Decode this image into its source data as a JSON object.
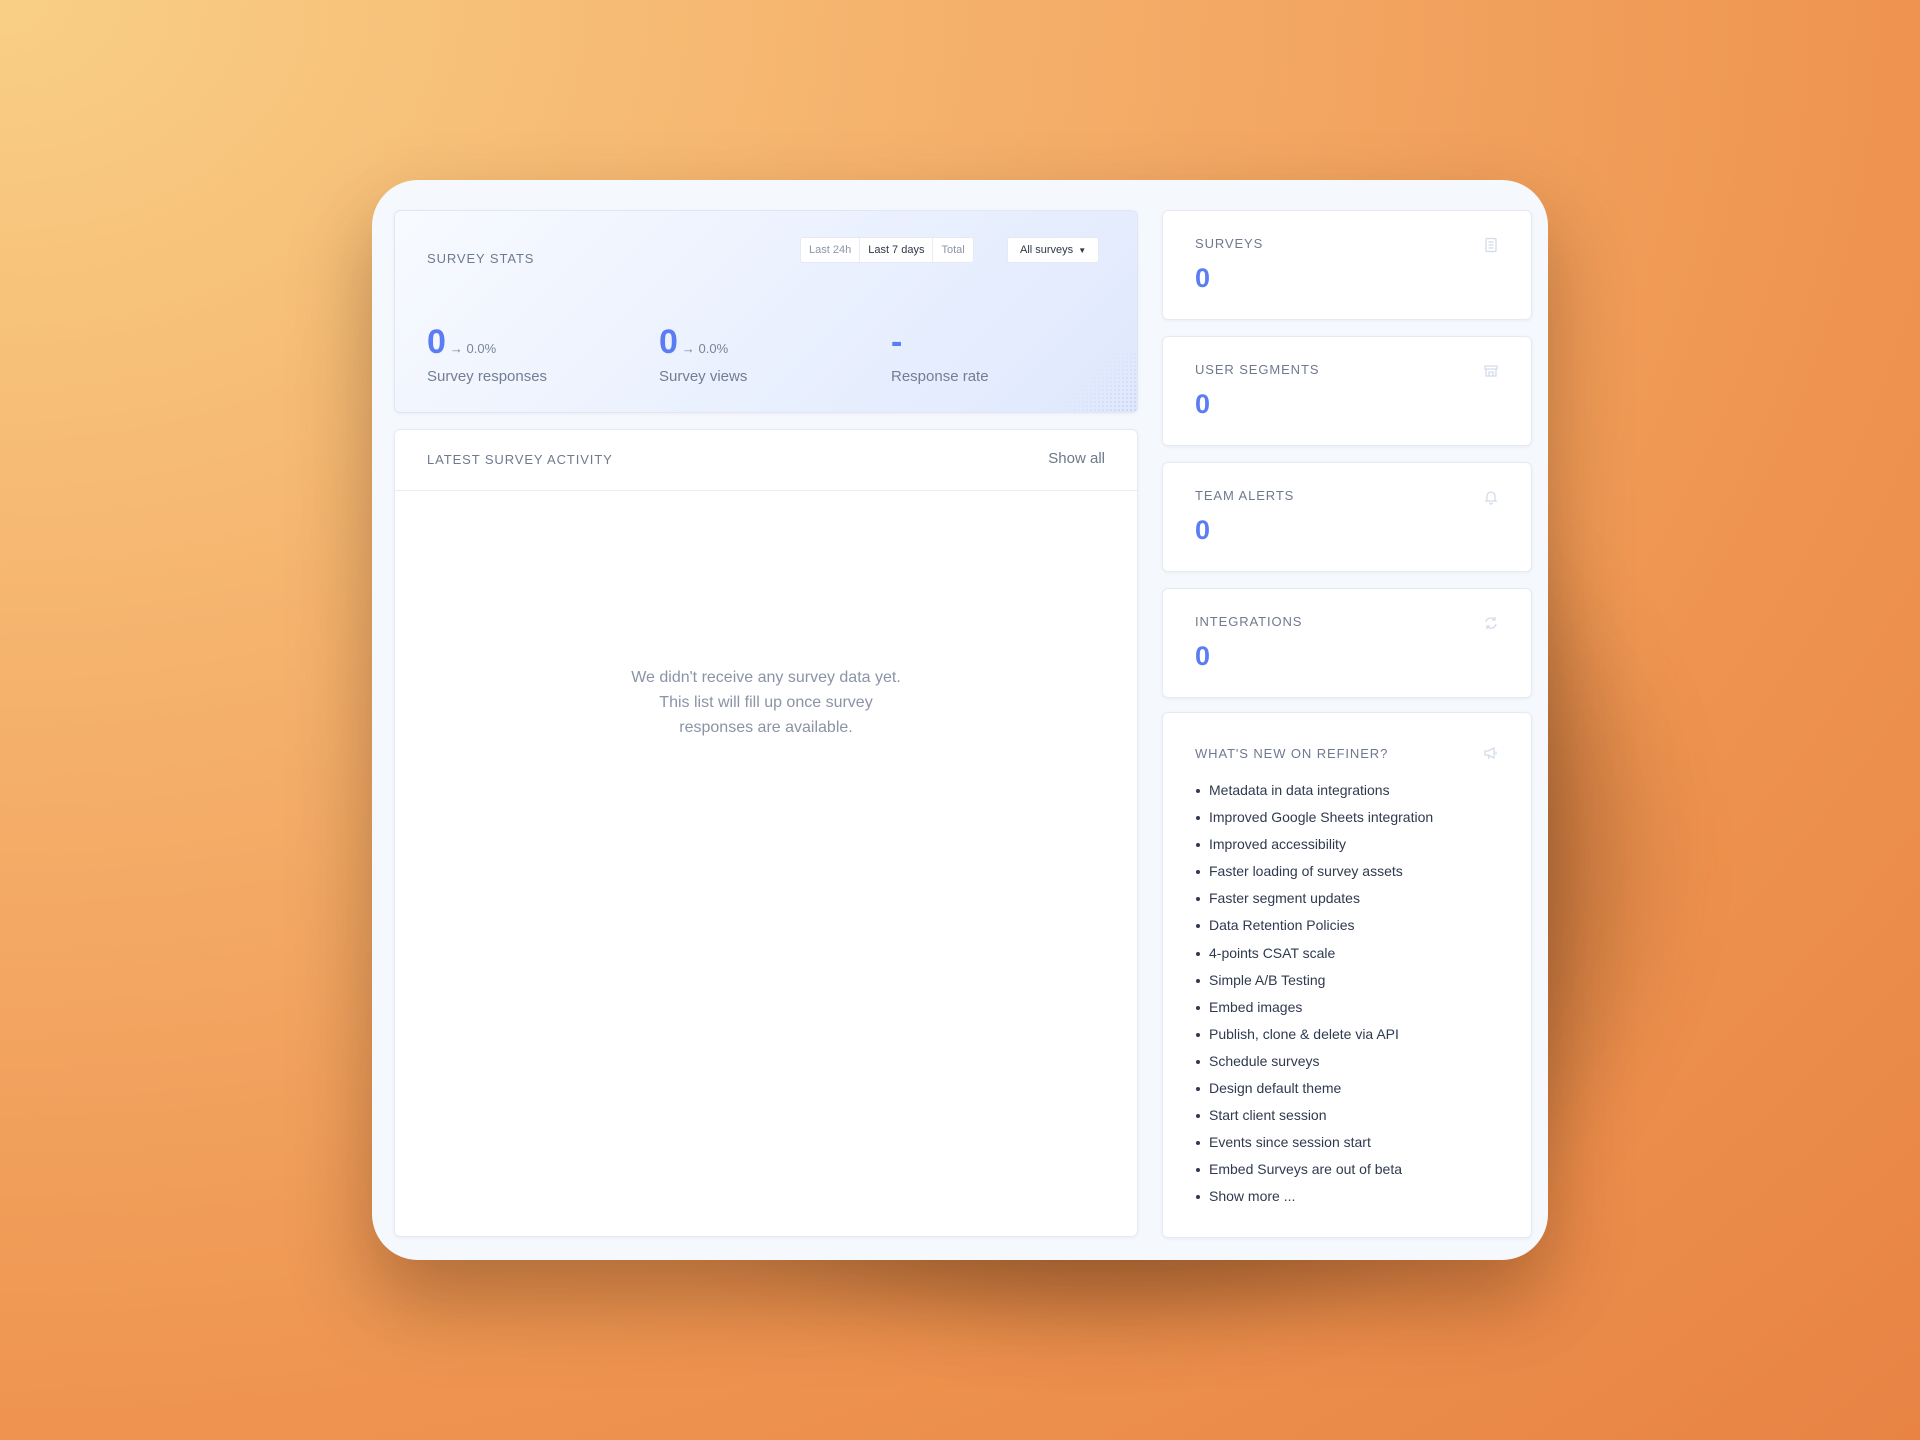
{
  "colors": {
    "accent": "#5b7cf3",
    "frame_bg": "#f5f8fd",
    "backdrop": "#f1a35f"
  },
  "stats": {
    "title": "SURVEY STATS",
    "ranges": [
      "Last 24h",
      "Last 7 days",
      "Total"
    ],
    "active_range": "Last 7 days",
    "filter": "All surveys",
    "items": [
      {
        "value": "0",
        "delta": "→ 0.0%",
        "label": "Survey responses"
      },
      {
        "value": "0",
        "delta": "→ 0.0%",
        "label": "Survey views"
      },
      {
        "value": "-",
        "delta": "",
        "label": "Response rate"
      }
    ]
  },
  "activity": {
    "title": "LATEST SURVEY ACTIVITY",
    "show_all": "Show all",
    "empty": [
      "We didn't receive any survey data yet.",
      "This list will fill up once survey",
      "responses are available."
    ]
  },
  "sidebar": {
    "cards": [
      {
        "title": "SURVEYS",
        "value": "0",
        "icon": "document-icon"
      },
      {
        "title": "USER SEGMENTS",
        "value": "0",
        "icon": "store-icon"
      },
      {
        "title": "TEAM ALERTS",
        "value": "0",
        "icon": "bell-icon"
      },
      {
        "title": "INTEGRATIONS",
        "value": "0",
        "icon": "sync-icon"
      }
    ],
    "news": {
      "title": "WHAT'S NEW ON REFINER?",
      "icon": "megaphone-icon",
      "items": [
        "Metadata in data integrations",
        "Improved Google Sheets integration",
        "Improved accessibility",
        "Faster loading of survey assets",
        "Faster segment updates",
        "Data Retention Policies",
        "4-points CSAT scale",
        "Simple A/B Testing",
        "Embed images",
        "Publish, clone & delete via API",
        "Schedule surveys",
        "Design default theme",
        "Start client session",
        "Events since session start",
        "Embed Surveys are out of beta",
        "Show more ..."
      ]
    }
  }
}
